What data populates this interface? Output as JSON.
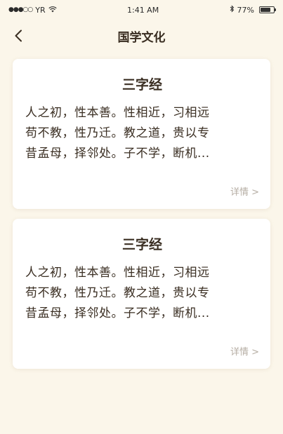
{
  "status_bar": {
    "carrier": "YR",
    "time": "1:41 AM",
    "battery_percent": "77%",
    "battery_level": 0.77
  },
  "nav": {
    "back_icon": "chevron-left-icon",
    "title": "国学文化"
  },
  "cards": [
    {
      "title": "三字经",
      "lines": [
        "人之初，性本善。性相近，习相远",
        "苟不教，性乃迁。教之道，贵以专",
        "昔孟母，择邻处。子不学，断机..."
      ],
      "detail_label": "详情 >"
    },
    {
      "title": "三字经",
      "lines": [
        "人之初，性本善。性相近，习相远",
        "苟不教，性乃迁。教之道，贵以专",
        "昔孟母，择邻处。子不学，断机..."
      ],
      "detail_label": "详情 >"
    }
  ],
  "colors": {
    "background": "#fbf6ea",
    "text": "#3a2e22",
    "muted": "#b5ada3"
  }
}
